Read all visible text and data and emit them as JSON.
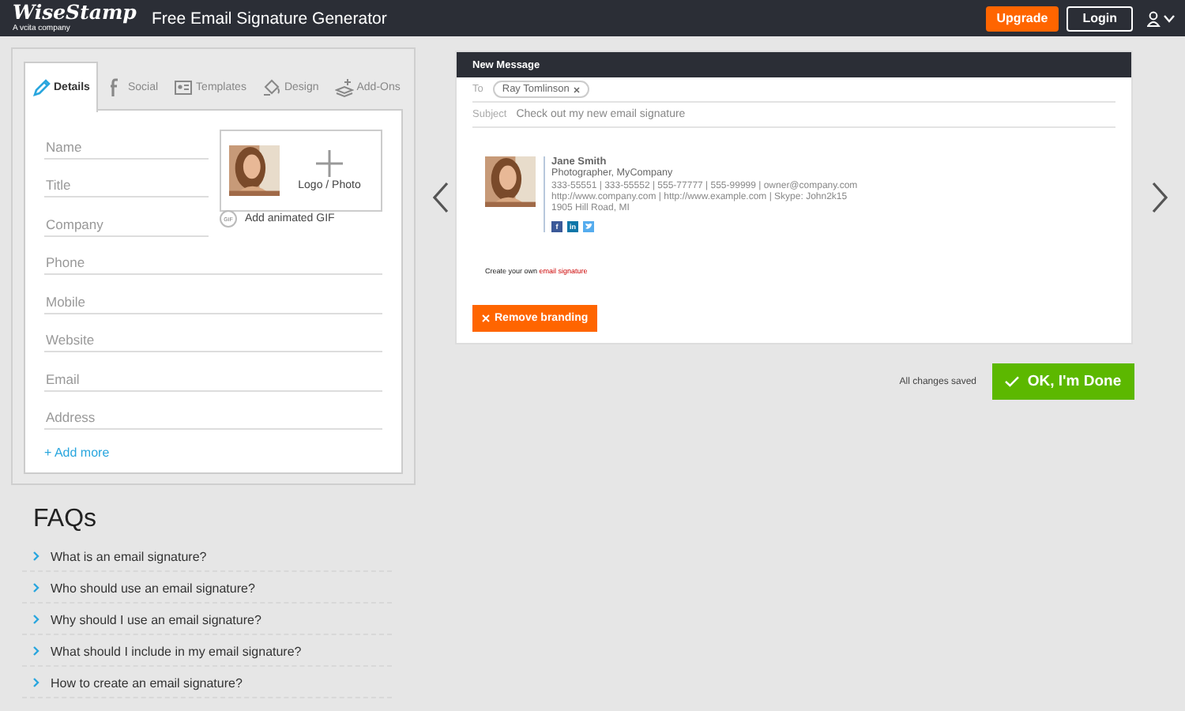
{
  "header": {
    "logo": "WiseStamp",
    "logo_tagline": "A vcita company",
    "title": "Free Email Signature Generator",
    "buttons": [
      {
        "kind": "upgrade",
        "label": "Upgrade"
      },
      {
        "kind": "login",
        "label": "Login"
      }
    ]
  },
  "editor": {
    "tabs": [
      {
        "kind": "details",
        "label": "Details",
        "selected": true
      },
      {
        "kind": "social",
        "label": "Social",
        "selected": false
      },
      {
        "kind": "templates",
        "label": "Templates",
        "selected": false
      },
      {
        "kind": "design",
        "label": "Design",
        "selected": false
      },
      {
        "kind": "addons",
        "label": "Add-Ons",
        "selected": false
      }
    ],
    "fields": [
      {
        "placeholder": "Name"
      },
      {
        "placeholder": "Title"
      },
      {
        "placeholder": "Company"
      },
      {
        "placeholder": "Phone"
      },
      {
        "placeholder": "Mobile"
      },
      {
        "placeholder": "Website"
      },
      {
        "placeholder": "Email"
      },
      {
        "placeholder": "Address"
      }
    ],
    "photo_label": "Logo / Photo",
    "gif_badge": "GIF",
    "gif_label": "Add animated GIF",
    "add_more": "+ Add more"
  },
  "faq": {
    "title": "FAQs",
    "items": [
      "What is an email signature?",
      "Who should use an email signature?",
      "Why should I use an email signature?",
      "What should I include in my email signature?",
      "How to create an email signature?"
    ]
  },
  "message": {
    "title": "New Message",
    "to_label": "To",
    "recipient": "Ray Tomlinson",
    "subject_label": "Subject",
    "subject": "Check out my new email signature",
    "signature": {
      "name": "Jane Smith",
      "role": "Photographer, MyCompany",
      "lines": [
        "333-55551 | 333-55552 | 555-77777 | 555-99999 | owner@company.com",
        "http://www.company.com | http://www.example.com | Skype: John2k15",
        "1905 Hill Road, MI"
      ],
      "social": [
        {
          "kind": "facebook",
          "glyph": "f"
        },
        {
          "kind": "linkedin",
          "glyph": "in"
        },
        {
          "kind": "twitter"
        }
      ]
    },
    "branding_text": "Create your own",
    "branding_link": "email signature",
    "remove_button": "Remove branding"
  },
  "status": "All changes saved",
  "done_button": "OK, I'm Done"
}
